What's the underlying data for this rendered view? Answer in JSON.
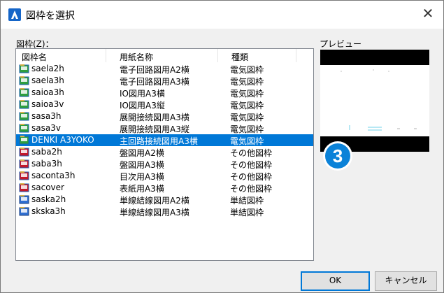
{
  "window": {
    "title": "図枠を選択",
    "close_glyph": "✕"
  },
  "list": {
    "label": "図枠(Z)：",
    "columns": [
      "図枠名",
      "用紙名称",
      "種類"
    ],
    "rows": [
      {
        "name": "saela2h",
        "paper": "電子回路図用A2横",
        "type": "電気図枠",
        "icon": "electric-frame-icon"
      },
      {
        "name": "saela3h",
        "paper": "電子回路図用A3横",
        "type": "電気図枠",
        "icon": "electric-frame-icon"
      },
      {
        "name": "saioa3h",
        "paper": "IO図用A3横",
        "type": "電気図枠",
        "icon": "electric-frame-icon"
      },
      {
        "name": "saioa3v",
        "paper": "IO図用A3縦",
        "type": "電気図枠",
        "icon": "electric-frame-icon"
      },
      {
        "name": "sasa3h",
        "paper": "展開接続図用A3横",
        "type": "電気図枠",
        "icon": "electric-frame-icon"
      },
      {
        "name": "sasa3v",
        "paper": "展開接続図用A3縦",
        "type": "電気図枠",
        "icon": "electric-frame-icon"
      },
      {
        "name": "DENKI A3YOKO",
        "paper": "主回路接続図用A3横",
        "type": "電気図枠",
        "icon": "electric-frame-icon",
        "selected": true
      },
      {
        "name": "saba2h",
        "paper": "盤図用A2横",
        "type": "その他図枠",
        "icon": "other-frame-icon"
      },
      {
        "name": "saba3h",
        "paper": "盤図用A3横",
        "type": "その他図枠",
        "icon": "other-frame-icon"
      },
      {
        "name": "saconta3h",
        "paper": "目次用A3横",
        "type": "その他図枠",
        "icon": "other-frame-icon"
      },
      {
        "name": "sacover",
        "paper": "表紙用A3横",
        "type": "その他図枠",
        "icon": "other-frame-icon"
      },
      {
        "name": "saska2h",
        "paper": "単線結線図用A2横",
        "type": "単結図枠",
        "icon": "single-line-frame-icon"
      },
      {
        "name": "skska3h",
        "paper": "単線結線図用A3横",
        "type": "単結図枠",
        "icon": "single-line-frame-icon"
      }
    ]
  },
  "preview": {
    "label": "プレビュー"
  },
  "step_badge": "3",
  "buttons": {
    "ok": "OK",
    "cancel": "キャンセル"
  },
  "colors": {
    "selection": "#0078d7",
    "badge": "#0b82d8",
    "app_icon": "#1565c8"
  }
}
